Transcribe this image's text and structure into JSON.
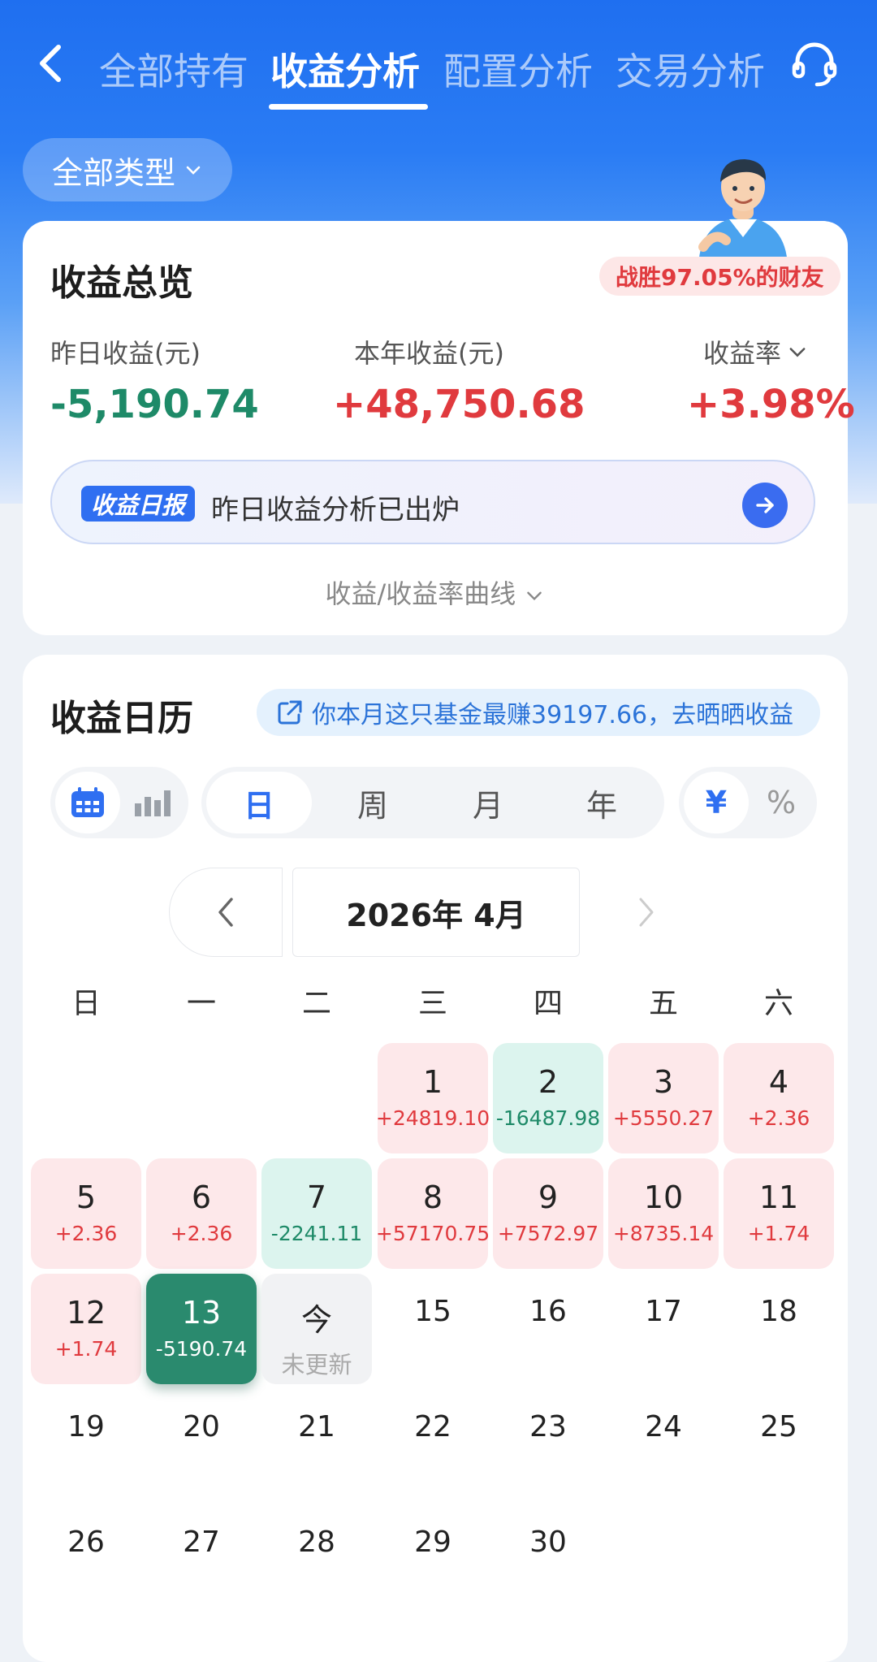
{
  "nav": {
    "tabs": [
      "全部持有",
      "收益分析",
      "配置分析",
      "交易分析"
    ],
    "active_tab": "收益分析"
  },
  "filter": {
    "type_label": "全部类型"
  },
  "overview": {
    "title": "收益总览",
    "win_badge": "战胜97.05%的财友",
    "yesterday_label": "昨日收益(元)",
    "yesterday_value": "-5,190.74",
    "year_label": "本年收益(元)",
    "year_value": "+48,750.68",
    "rate_label": "收益率",
    "rate_value": "+3.98%",
    "report_tag": "收益日报",
    "report_text": "昨日收益分析已出炉",
    "curve_toggle": "收益/收益率曲线"
  },
  "calendar": {
    "title": "收益日历",
    "promo": "你本月这只基金最赚39197.66，去晒晒收益",
    "periods": [
      "日",
      "周",
      "月",
      "年"
    ],
    "active_period": "日",
    "units": [
      "¥",
      "%"
    ],
    "active_unit": "¥",
    "month_label": "2026年 4月",
    "weekdays": [
      "日",
      "一",
      "二",
      "三",
      "四",
      "五",
      "六"
    ],
    "days": [
      {
        "d": "1",
        "v": "+24819.10",
        "s": "pos"
      },
      {
        "d": "2",
        "v": "-16487.98",
        "s": "neg"
      },
      {
        "d": "3",
        "v": "+5550.27",
        "s": "pos"
      },
      {
        "d": "4",
        "v": "+2.36",
        "s": "pos"
      },
      {
        "d": "5",
        "v": "+2.36",
        "s": "pos"
      },
      {
        "d": "6",
        "v": "+2.36",
        "s": "pos"
      },
      {
        "d": "7",
        "v": "-2241.11",
        "s": "neg"
      },
      {
        "d": "8",
        "v": "+57170.75",
        "s": "pos"
      },
      {
        "d": "9",
        "v": "+7572.97",
        "s": "pos"
      },
      {
        "d": "10",
        "v": "+8735.14",
        "s": "pos"
      },
      {
        "d": "11",
        "v": "+1.74",
        "s": "pos"
      },
      {
        "d": "12",
        "v": "+1.74",
        "s": "pos"
      },
      {
        "d": "13",
        "v": "-5190.74",
        "s": "sel"
      },
      {
        "d": "今",
        "v": "未更新",
        "s": "today"
      },
      {
        "d": "15",
        "v": "",
        "s": "plain"
      },
      {
        "d": "16",
        "v": "",
        "s": "plain"
      },
      {
        "d": "17",
        "v": "",
        "s": "plain"
      },
      {
        "d": "18",
        "v": "",
        "s": "plain"
      },
      {
        "d": "19",
        "v": "",
        "s": "plain"
      },
      {
        "d": "20",
        "v": "",
        "s": "plain"
      },
      {
        "d": "21",
        "v": "",
        "s": "plain"
      },
      {
        "d": "22",
        "v": "",
        "s": "plain"
      },
      {
        "d": "23",
        "v": "",
        "s": "plain"
      },
      {
        "d": "24",
        "v": "",
        "s": "plain"
      },
      {
        "d": "25",
        "v": "",
        "s": "plain"
      },
      {
        "d": "26",
        "v": "",
        "s": "plain"
      },
      {
        "d": "27",
        "v": "",
        "s": "plain"
      },
      {
        "d": "28",
        "v": "",
        "s": "plain"
      },
      {
        "d": "29",
        "v": "",
        "s": "plain"
      },
      {
        "d": "30",
        "v": "",
        "s": "plain"
      }
    ]
  },
  "colors": {
    "brand_blue": "#2f6ff1",
    "gain_red": "#e03a3e",
    "loss_green": "#1e8a68",
    "selected_green": "#2a8a6e"
  },
  "icons": [
    "back-arrow-icon",
    "customer-service-icon",
    "chevron-down-icon",
    "arrow-right-icon",
    "share-icon",
    "calendar-icon",
    "bar-chart-icon",
    "chevron-left-icon",
    "chevron-right-icon"
  ]
}
